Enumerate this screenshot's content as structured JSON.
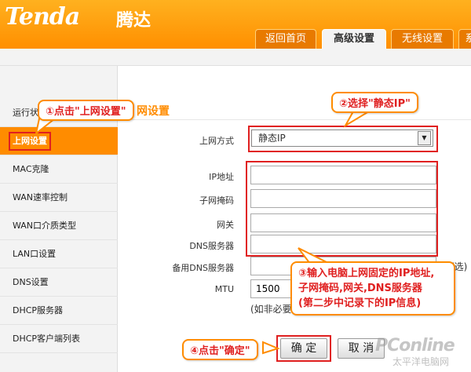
{
  "brand": {
    "logo": "Tenda",
    "logo_cn": "腾达"
  },
  "nav": {
    "tabs": [
      {
        "label": "返回首页"
      },
      {
        "label": "高级设置"
      },
      {
        "label": "无线设置"
      },
      {
        "label": "系"
      }
    ],
    "active": "高级设置"
  },
  "sidebar": {
    "items": [
      {
        "label": "运行状"
      },
      {
        "label": "上网设置"
      },
      {
        "label": "MAC克隆"
      },
      {
        "label": "WAN速率控制"
      },
      {
        "label": "WAN口介质类型"
      },
      {
        "label": "LAN口设置"
      },
      {
        "label": "DNS设置"
      },
      {
        "label": "DHCP服务器"
      },
      {
        "label": "DHCP客户端列表"
      }
    ]
  },
  "main": {
    "title": "网设置",
    "mode_label": "上网方式",
    "mode_value": "静态IP",
    "fields": [
      {
        "label": "IP地址",
        "value": ""
      },
      {
        "label": "子网掩码",
        "value": ""
      },
      {
        "label": "网关",
        "value": ""
      },
      {
        "label": "DNS服务器",
        "value": ""
      },
      {
        "label": "备用DNS服务器",
        "value": "",
        "note": "(可选)"
      },
      {
        "label": "MTU",
        "value": "1500",
        "note": "(如非必要"
      }
    ],
    "ok_button": "确 定",
    "cancel_button": "取 消"
  },
  "callouts": {
    "step1": "①点击\"上网设置\"",
    "step2": "②选择\"静态IP\"",
    "step3_line1": "③输入电脑上网固定的IP地址,",
    "step3_line2": "子网掩码,网关,DNS服务器",
    "step3_line3": "(第二步中记录下的IP信息)",
    "step4": "④点击\"确定\""
  },
  "watermark": {
    "brand": "PConline",
    "sub": "太平洋电脑网"
  },
  "colors": {
    "accent": "#ff8c00",
    "annotation": "#e02020"
  }
}
